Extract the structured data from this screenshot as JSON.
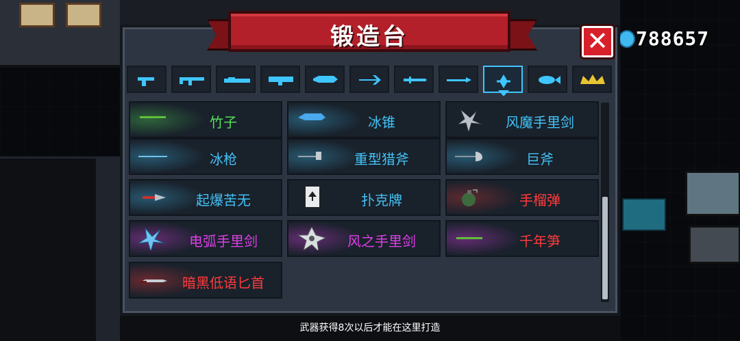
{
  "title": "锻造台",
  "close_label": "✕",
  "coins": "788657",
  "hint": "武器获得8次以后才能在这里打造",
  "colors": {
    "green": "#56e05a",
    "blue": "#43c2f5",
    "red": "#ff3b3b",
    "purple": "#dd3fe6",
    "accent": "#3fc6ff",
    "banner": "#b3202a"
  },
  "tabs": [
    {
      "icon": "pistol-icon",
      "active": false
    },
    {
      "icon": "rifle-icon",
      "active": false
    },
    {
      "icon": "shotgun-icon",
      "active": false
    },
    {
      "icon": "launcher-icon",
      "active": false
    },
    {
      "icon": "laser-gun-icon",
      "active": false
    },
    {
      "icon": "bow-icon",
      "active": false
    },
    {
      "icon": "sword-icon",
      "active": false
    },
    {
      "icon": "spear-icon",
      "active": false
    },
    {
      "icon": "throwing-icon",
      "active": true
    },
    {
      "icon": "fish-icon",
      "active": false
    },
    {
      "icon": "crown-icon",
      "active": false
    }
  ],
  "items": [
    {
      "name": "竹子",
      "rarity": "green",
      "icon": "bamboo-icon"
    },
    {
      "name": "冰锥",
      "rarity": "blue",
      "icon": "ice-cone-icon"
    },
    {
      "name": "风魔手里剑",
      "rarity": "blue",
      "icon": "shuriken-icon"
    },
    {
      "name": "冰枪",
      "rarity": "blue",
      "icon": "ice-spear-icon"
    },
    {
      "name": "重型猎斧",
      "rarity": "blue",
      "icon": "axe-icon"
    },
    {
      "name": "巨斧",
      "rarity": "blue",
      "icon": "great-axe-icon"
    },
    {
      "name": "起爆苦无",
      "rarity": "blue",
      "icon": "kunai-icon"
    },
    {
      "name": "扑克牌",
      "rarity": "blue",
      "icon": "card-icon"
    },
    {
      "name": "手榴弹",
      "rarity": "red",
      "icon": "grenade-icon"
    },
    {
      "name": "电弧手里剑",
      "rarity": "purple",
      "icon": "arc-shuriken-icon"
    },
    {
      "name": "风之手里剑",
      "rarity": "purple",
      "icon": "wind-shuriken-icon"
    },
    {
      "name": "千年笋",
      "rarity": "red",
      "icon": "bamboo-shoot-icon"
    },
    {
      "name": "暗黑低语匕首",
      "rarity": "red",
      "icon": "dagger-icon"
    }
  ]
}
